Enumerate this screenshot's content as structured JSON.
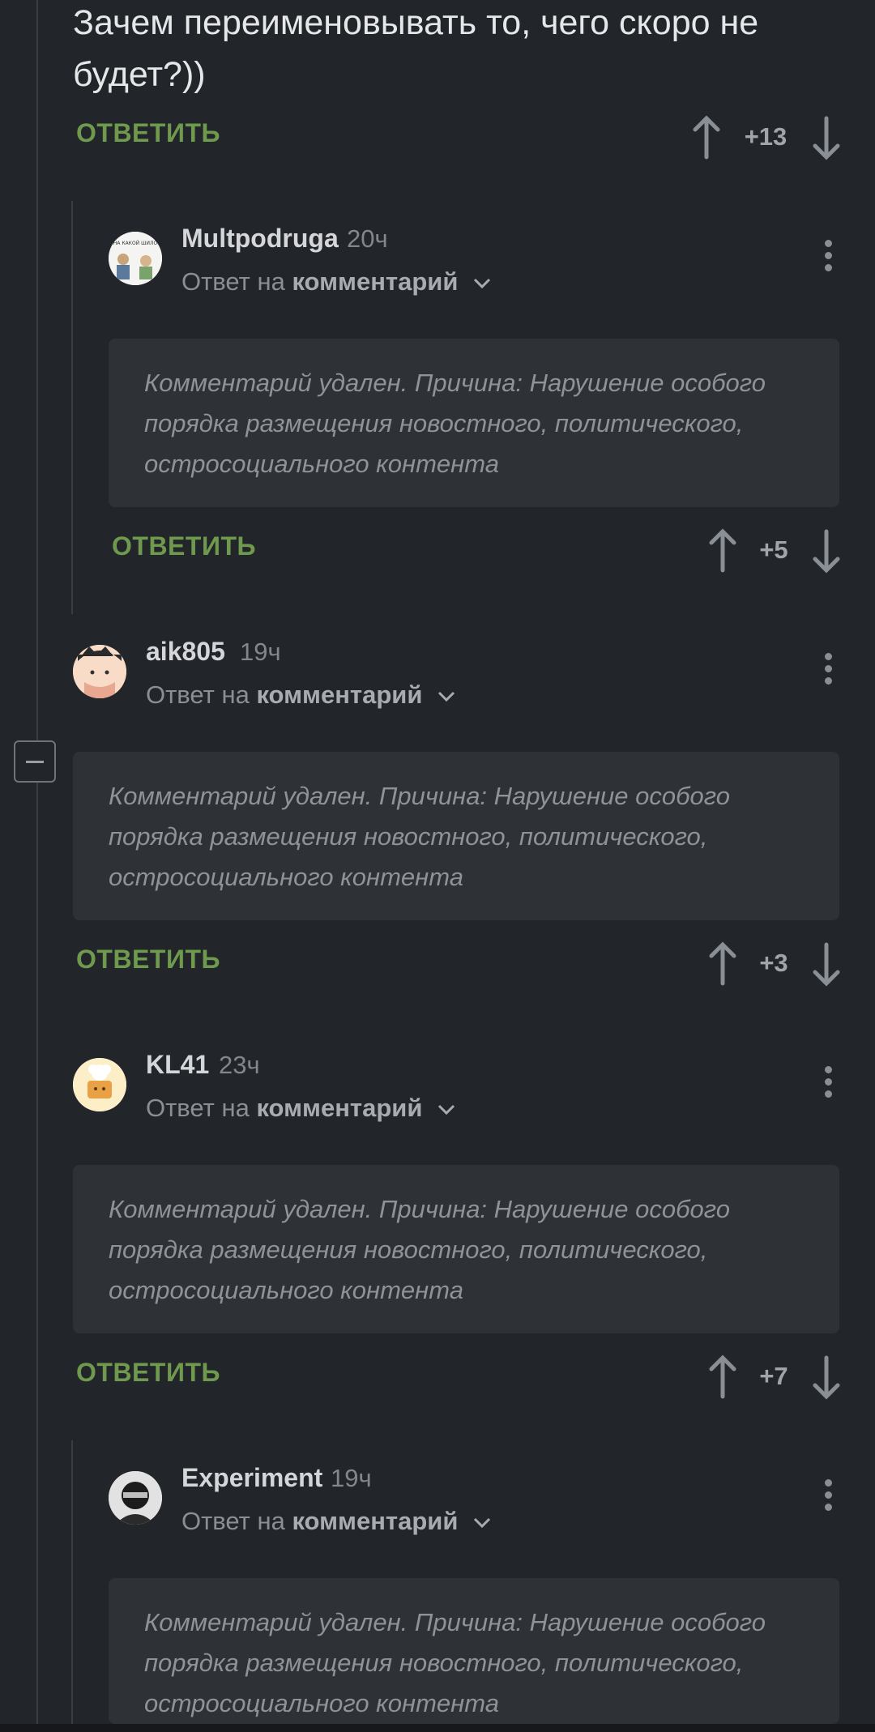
{
  "top_comment": {
    "text": "Зачем переименовывать то, чего скоро не будет?))",
    "reply_label": "ОТВЕТИТЬ",
    "score": "+13"
  },
  "comments": [
    {
      "author": "Multpodruga",
      "time": "20ч",
      "reply_prefix": "Ответ на",
      "reply_target": "комментарий",
      "deleted_text": "Комментарий удален. Причина: Нарушение особого порядка размещения новостного, политического, остросоциального контента",
      "reply_label": "ОТВЕТИТЬ",
      "score": "+5",
      "avatar_caption": "НА КАКОЙ ШИЛО"
    },
    {
      "author": "aik805",
      "time": "19ч",
      "reply_prefix": "Ответ на",
      "reply_target": "комментарий",
      "deleted_text": "Комментарий удален. Причина: Нарушение особого порядка размещения новостного, политического, остросоциального контента",
      "reply_label": "ОТВЕТИТЬ",
      "score": "+3"
    },
    {
      "author": "KL41",
      "time": "23ч",
      "reply_prefix": "Ответ на",
      "reply_target": "комментарий",
      "deleted_text": "Комментарий удален. Причина: Нарушение особого порядка размещения новостного, политического, остросоциального контента",
      "reply_label": "ОТВЕТИТЬ",
      "score": "+7"
    },
    {
      "author": "Experiment",
      "time": "19ч",
      "reply_prefix": "Ответ на",
      "reply_target": "комментарий",
      "deleted_text": "Комментарий удален. Причина: Нарушение особого порядка размещения новостного, политического, остросоциального контента"
    }
  ],
  "colors": {
    "background": "#222529",
    "accent_green": "#6f9a4d",
    "deleted_box": "#2e3136"
  },
  "icons": [
    "arrow-up-icon",
    "arrow-down-icon",
    "more-vertical-icon",
    "chevron-down-icon",
    "collapse-minus-icon"
  ]
}
